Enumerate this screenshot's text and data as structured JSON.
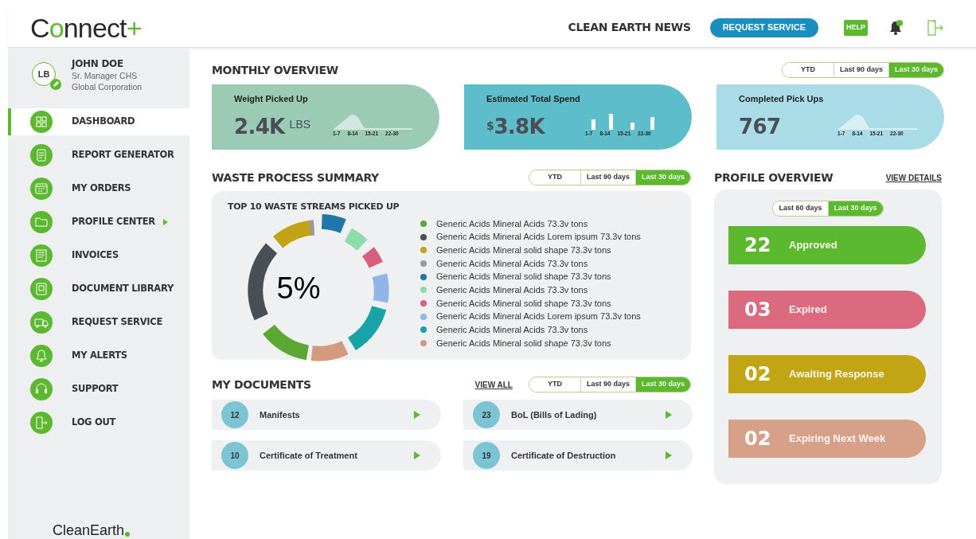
{
  "header": {
    "logo": [
      {
        "text": "C",
        "accent": false
      },
      {
        "text": "o",
        "accent": true
      },
      {
        "text": "nnect",
        "accent": false
      },
      {
        "text": "+",
        "accent": true
      }
    ],
    "news_link": "CLEAN EARTH NEWS",
    "request_button": "REQUEST SERVICE",
    "help_label": "HELP"
  },
  "user": {
    "initials": "LB",
    "name": "JOHN DOE",
    "title": "Sr. Manager CHS",
    "company": "Global Corporation"
  },
  "sidebar": {
    "items": [
      {
        "label": "DASHBOARD",
        "selected": true,
        "has_submenu": false
      },
      {
        "label": "REPORT GENERATOR",
        "selected": false,
        "has_submenu": false
      },
      {
        "label": "MY ORDERS",
        "selected": false,
        "has_submenu": false
      },
      {
        "label": "PROFILE CENTER",
        "selected": false,
        "has_submenu": true
      },
      {
        "label": "INVOICES",
        "selected": false,
        "has_submenu": false
      },
      {
        "label": "DOCUMENT LIBRARY",
        "selected": false,
        "has_submenu": false
      },
      {
        "label": "REQUEST SERVICE",
        "selected": false,
        "has_submenu": false
      },
      {
        "label": "MY ALERTS",
        "selected": false,
        "has_submenu": false
      },
      {
        "label": "SUPPORT",
        "selected": false,
        "has_submenu": false
      },
      {
        "label": "LOG OUT",
        "selected": false,
        "has_submenu": false
      }
    ],
    "footer_logo": "CleanEarth"
  },
  "monthly_overview": {
    "title": "MONTHLY OVERVIEW",
    "ranges": [
      {
        "label": "YTD",
        "selected": false
      },
      {
        "label": "Last 90 days",
        "selected": false
      },
      {
        "label": "Last 30 days",
        "selected": true
      }
    ],
    "cards": [
      {
        "label": "Weight Picked Up",
        "value": "2.4K",
        "unit": "LBS",
        "kind": "area",
        "color": "#9ccbb5",
        "ticks": [
          "1-7",
          "8-14",
          "15-21",
          "22-30"
        ]
      },
      {
        "label": "Estimated Total Spend",
        "prefix": "$",
        "value": "3.8K",
        "kind": "bars",
        "color": "#5dbdca",
        "ticks": [
          "1-7",
          "8-14",
          "15-21",
          "22-30"
        ]
      },
      {
        "label": "Completed Pick Ups",
        "value": "767",
        "kind": "area",
        "color": "#a9dce6",
        "ticks": [
          "1-7",
          "8-14",
          "15-21",
          "22-30"
        ]
      }
    ]
  },
  "waste_summary": {
    "title": "WASTE PROCESS SUMMARY",
    "ranges": [
      {
        "label": "YTD",
        "selected": false
      },
      {
        "label": "Last 90 days",
        "selected": false
      },
      {
        "label": "Last 30 days",
        "selected": true
      }
    ],
    "panel_title": "TOP 10 WASTE STREAMS PICKED UP",
    "center_label": "5%",
    "legend": [
      {
        "label": "Generic Acids Mineral Acids 73.3v tons",
        "color": "#5aa832"
      },
      {
        "label": "Generic Acids Mineral Acids Lorem ipsum 73.3v tons",
        "color": "#4a4f57"
      },
      {
        "label": "Generic Acids Mineral solid shape 73.3v tons",
        "color": "#c4a216"
      },
      {
        "label": "Generic Acids Mineral Acids 73.3v tons",
        "color": "#9a9a9a"
      },
      {
        "label": "Generic Acids Mineral solid shape 73.3v tons",
        "color": "#1f77a8"
      },
      {
        "label": "Generic Acids Mineral Acids 73.3v tons",
        "color": "#8fdcaa"
      },
      {
        "label": "Generic Acids Mineral solid shape 73.3v tons",
        "color": "#d9607a"
      },
      {
        "label": "Generic Acids Mineral Acids Lorem ipsum 73.3v tons",
        "color": "#92b5e8"
      },
      {
        "label": "Generic Acids Mineral Acids 73.3v tons",
        "color": "#17a3a8"
      },
      {
        "label": "Generic Acids Mineral solid shape 73.3v tons",
        "color": "#d49a80"
      }
    ]
  },
  "my_documents": {
    "title": "MY DOCUMENTS",
    "view_all": "VIEW ALL",
    "ranges": [
      {
        "label": "YTD",
        "selected": false
      },
      {
        "label": "Last 90 days",
        "selected": false
      },
      {
        "label": "Last 30 days",
        "selected": true
      }
    ],
    "items": [
      {
        "count": "12",
        "label": "Manifests"
      },
      {
        "count": "23",
        "label": "BoL (Bills of Lading)"
      },
      {
        "count": "10",
        "label": "Certificate of Treatment"
      },
      {
        "count": "19",
        "label": "Certificate of Destruction"
      }
    ]
  },
  "profile_overview": {
    "title": "PROFILE OVERVIEW",
    "view_details": "VIEW DETAILS",
    "ranges": [
      {
        "label": "Last 60 days",
        "selected": false
      },
      {
        "label": "Last 30 days",
        "selected": true
      }
    ],
    "statuses": [
      {
        "count": "22",
        "label": "Approved",
        "color": "#5cb82e"
      },
      {
        "count": "03",
        "label": "Expired",
        "color": "#dc6a7e"
      },
      {
        "count": "02",
        "label": "Awaiting Response",
        "color": "#c2a515"
      },
      {
        "count": "02",
        "label": "Expiring Next Week",
        "color": "#d7a088"
      }
    ]
  }
}
